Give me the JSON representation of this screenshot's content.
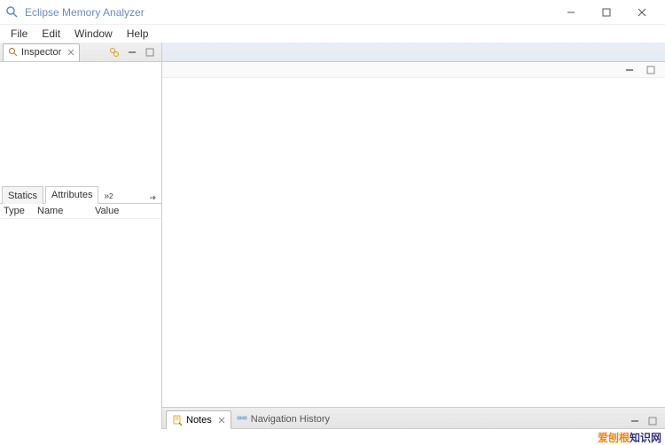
{
  "window": {
    "title": "Eclipse Memory Analyzer"
  },
  "menu": {
    "items": [
      "File",
      "Edit",
      "Window",
      "Help"
    ]
  },
  "inspector_tab": {
    "label": "Inspector"
  },
  "sub_tabs": {
    "statics": "Statics",
    "attributes": "Attributes"
  },
  "table_columns": {
    "type": "Type",
    "name": "Name",
    "value": "Value"
  },
  "bottom_tabs": {
    "notes": "Notes",
    "nav_history": "Navigation History"
  },
  "watermark": {
    "part1": "爱刨根",
    "part2": "知识网"
  }
}
